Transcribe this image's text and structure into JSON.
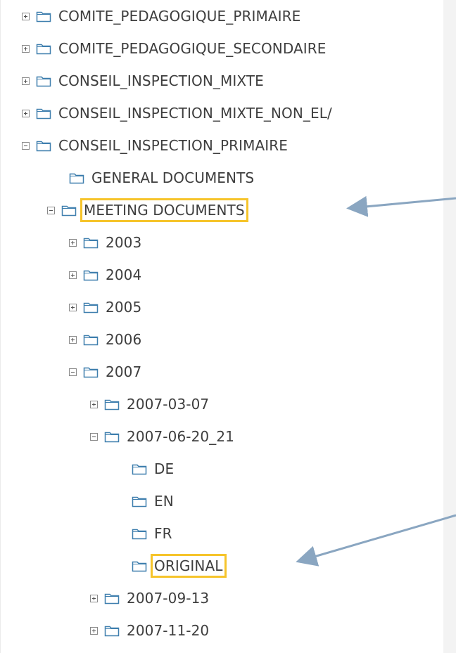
{
  "tree": {
    "items": [
      {
        "label": "COMITE_PEDAGOGIQUE_PRIMAIRE",
        "toggle": "plus"
      },
      {
        "label": "COMITE_PEDAGOGIQUE_SECONDAIRE",
        "toggle": "plus"
      },
      {
        "label": "CONSEIL_INSPECTION_MIXTE",
        "toggle": "plus"
      },
      {
        "label": "CONSEIL_INSPECTION_MIXTE_NON_EL/",
        "toggle": "plus"
      },
      {
        "label": "CONSEIL_INSPECTION_PRIMAIRE",
        "toggle": "minus"
      },
      {
        "label": "GENERAL DOCUMENTS",
        "toggle": "none"
      },
      {
        "label": "MEETING DOCUMENTS",
        "toggle": "minus",
        "highlighted": true
      },
      {
        "label": "2003",
        "toggle": "plus"
      },
      {
        "label": "2004",
        "toggle": "plus"
      },
      {
        "label": "2005",
        "toggle": "plus"
      },
      {
        "label": "2006",
        "toggle": "plus"
      },
      {
        "label": "2007",
        "toggle": "minus"
      },
      {
        "label": "2007-03-07",
        "toggle": "plus"
      },
      {
        "label": "2007-06-20_21",
        "toggle": "minus"
      },
      {
        "label": "DE",
        "toggle": "none"
      },
      {
        "label": "EN",
        "toggle": "none"
      },
      {
        "label": "FR",
        "toggle": "none"
      },
      {
        "label": "ORIGINAL",
        "toggle": "none",
        "highlighted": true
      },
      {
        "label": "2007-09-13",
        "toggle": "plus"
      },
      {
        "label": "2007-11-20",
        "toggle": "plus"
      }
    ]
  },
  "colors": {
    "highlight_box": "#f6c42b",
    "annotation_arrow": "#8aa6c1",
    "folder_outline": "#3f7fae",
    "text": "#3e3e3e"
  },
  "icons": {
    "folder": "folder-icon",
    "expand": "expand-plus-icon",
    "collapse": "collapse-minus-icon"
  }
}
